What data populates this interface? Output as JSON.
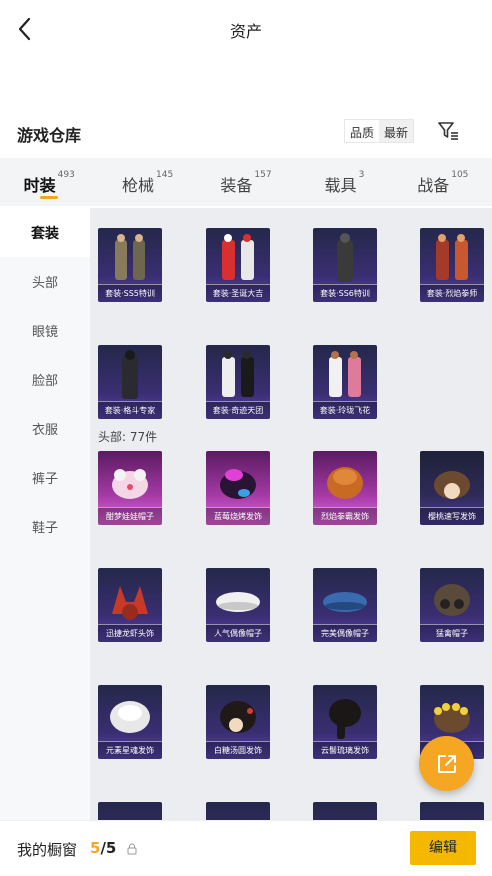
{
  "header": {
    "title": "资产"
  },
  "warehouse": {
    "title": "游戏仓库",
    "sort_options": [
      "品质",
      "最新"
    ],
    "active_sort": 1
  },
  "categories": [
    {
      "label": "时装",
      "count": "493",
      "active": true
    },
    {
      "label": "枪械",
      "count": "145",
      "active": false
    },
    {
      "label": "装备",
      "count": "157",
      "active": false
    },
    {
      "label": "载具",
      "count": "3",
      "active": false
    },
    {
      "label": "战备",
      "count": "105",
      "active": false
    }
  ],
  "side_nav": [
    {
      "label": "套装",
      "active": true
    },
    {
      "label": "头部",
      "active": false
    },
    {
      "label": "眼镜",
      "active": false
    },
    {
      "label": "脸部",
      "active": false
    },
    {
      "label": "衣服",
      "active": false
    },
    {
      "label": "裤子",
      "active": false
    },
    {
      "label": "鞋子",
      "active": false
    }
  ],
  "suits": [
    {
      "label": "套装·SS5特训",
      "rarity": "blue",
      "art": "soldier-pair"
    },
    {
      "label": "套装·圣诞大吉",
      "rarity": "blue",
      "art": "red-robot-pair"
    },
    {
      "label": "套装·SS6特训",
      "rarity": "blue",
      "art": "dark-soldier"
    },
    {
      "label": "套装·烈焰拳师",
      "rarity": "blue",
      "art": "fire-fighter-pair"
    },
    {
      "label": "套装·格斗专家",
      "rarity": "blue",
      "art": "dark-fighter"
    },
    {
      "label": "套装·奇迹天团",
      "rarity": "blue",
      "art": "idol-pair"
    },
    {
      "label": "套装·玲珑飞花",
      "rarity": "blue",
      "art": "flower-pair"
    }
  ],
  "head_section": {
    "label": "头部: 77件"
  },
  "head_items": [
    {
      "label": "酣梦娃娃帽子",
      "rarity": "pink",
      "art": "plush-hat"
    },
    {
      "label": "蓝莓烧烤发饰",
      "rarity": "pink",
      "art": "pink-hair"
    },
    {
      "label": "烈焰拳霸发饰",
      "rarity": "pink",
      "art": "orange-hair"
    },
    {
      "label": "樱桃速写发饰",
      "rarity": "dark",
      "art": "brown-hair"
    },
    {
      "label": "迅捷龙虾头饰",
      "rarity": "blue",
      "art": "lobster-hat"
    },
    {
      "label": "人气偶像帽子",
      "rarity": "blue",
      "art": "white-beret"
    },
    {
      "label": "完美偶像帽子",
      "rarity": "blue",
      "art": "blue-beret"
    },
    {
      "label": "猛禽帽子",
      "rarity": "blue",
      "art": "pilot-cap"
    },
    {
      "label": "元素星魂发饰",
      "rarity": "blue",
      "art": "white-hair"
    },
    {
      "label": "白糖汤圆发饰",
      "rarity": "blue",
      "art": "black-hair"
    },
    {
      "label": "云髻琉璃发饰",
      "rarity": "blue",
      "art": "long-black-hair"
    },
    {
      "label": "花冠发饰",
      "rarity": "blue",
      "art": "flower-crown"
    },
    {
      "label": "",
      "rarity": "blue",
      "art": "partial"
    },
    {
      "label": "",
      "rarity": "blue",
      "art": "partial"
    },
    {
      "label": "",
      "rarity": "blue",
      "art": "partial"
    },
    {
      "label": "",
      "rarity": "blue",
      "art": "partial"
    }
  ],
  "showcase": {
    "label": "我的橱窗",
    "current": "5",
    "separator": "/",
    "total": "5"
  },
  "edit_label": "编辑",
  "colors": {
    "accent": "#f5a623",
    "edit_button": "#f5b800"
  }
}
